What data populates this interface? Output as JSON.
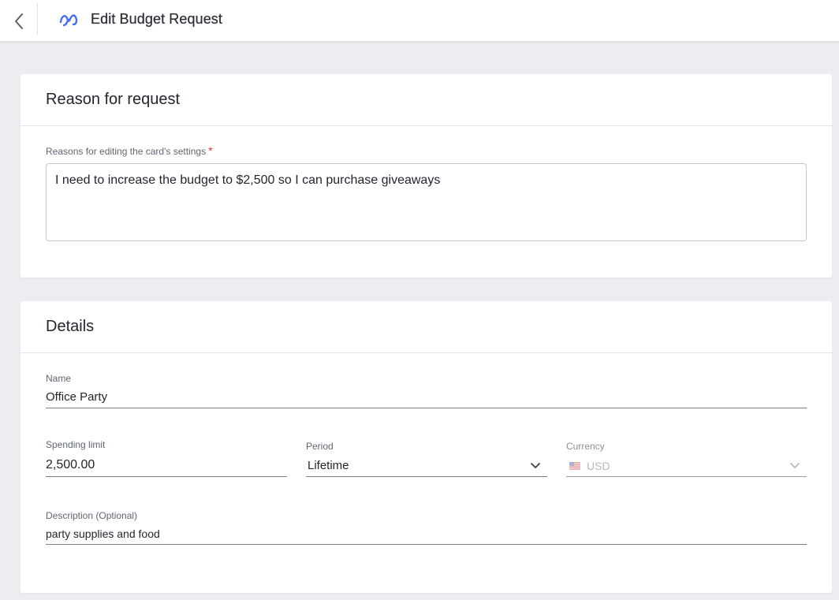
{
  "header": {
    "title": "Edit Budget Request",
    "back_icon": "chevron-left-icon",
    "logo_icon": "brand-logo-icon",
    "brand_color": "#4a6cf7"
  },
  "reason_card": {
    "title": "Reason for request",
    "field_label": "Reasons for editing the card's settings",
    "required_marker": "*",
    "value": "I need to increase the budget to $2,500 so I can purchase giveaways"
  },
  "details_card": {
    "title": "Details",
    "name": {
      "label": "Name",
      "value": "Office Party"
    },
    "spending_limit": {
      "label": "Spending limit",
      "value": "2,500.00"
    },
    "period": {
      "label": "Period",
      "value": "Lifetime",
      "icon": "chevron-down-icon"
    },
    "currency": {
      "label": "Currency",
      "value": "USD",
      "flag_icon": "us-flag-icon",
      "icon": "chevron-down-icon",
      "disabled": true
    },
    "description": {
      "label": "Description (Optional)",
      "value": "party supplies and food"
    }
  }
}
